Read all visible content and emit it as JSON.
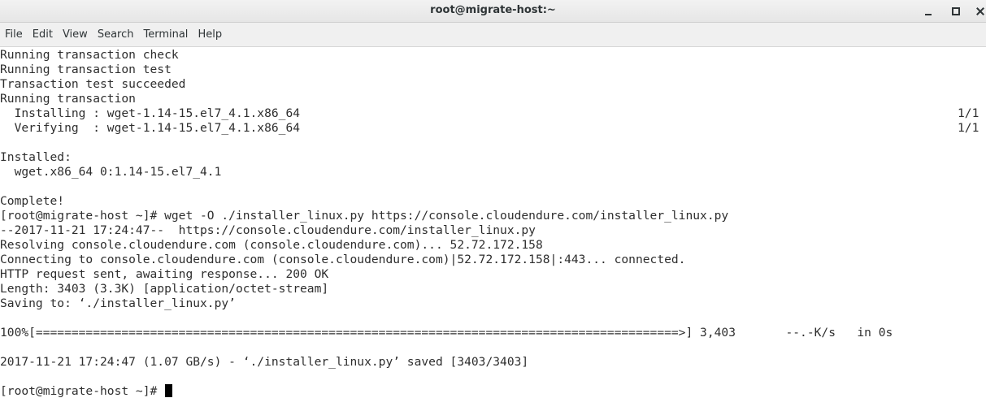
{
  "window": {
    "title": "root@migrate-host:~"
  },
  "menu": {
    "items": [
      "File",
      "Edit",
      "View",
      "Search",
      "Terminal",
      "Help"
    ]
  },
  "icons": {
    "minimize": "minimize-icon",
    "maximize": "maximize-icon",
    "close": "close-icon"
  },
  "colors": {
    "terminal_background": "#ffffff",
    "terminal_text": "#2e2e2e",
    "cursor": "#000000"
  },
  "terminal": {
    "lines": [
      "Running transaction check",
      "Running transaction test",
      "Transaction test succeeded",
      "Running transaction",
      "  Installing : wget-1.14-15.el7_4.1.x86_64",
      "  Verifying  : wget-1.14-15.el7_4.1.x86_64",
      "",
      "Installed:",
      "  wget.x86_64 0:1.14-15.el7_4.1",
      "",
      "Complete!",
      "[root@migrate-host ~]# wget -O ./installer_linux.py https://console.cloudendure.com/installer_linux.py",
      "--2017-11-21 17:24:47--  https://console.cloudendure.com/installer_linux.py",
      "Resolving console.cloudendure.com (console.cloudendure.com)... 52.72.172.158",
      "Connecting to console.cloudendure.com (console.cloudendure.com)|52.72.172.158|:443... connected.",
      "HTTP request sent, awaiting response... 200 OK",
      "Length: 3403 (3.3K) [application/octet-stream]",
      "Saving to: ‘./installer_linux.py’",
      "",
      "100%[==========================================================================================>] 3,403       --.-K/s   in 0s",
      "",
      "2017-11-21 17:24:47 (1.07 GB/s) - ‘./installer_linux.py’ saved [3403/3403]",
      "",
      "[root@migrate-host ~]# "
    ],
    "progress_install": "1/1",
    "progress_verify": "1/1"
  }
}
